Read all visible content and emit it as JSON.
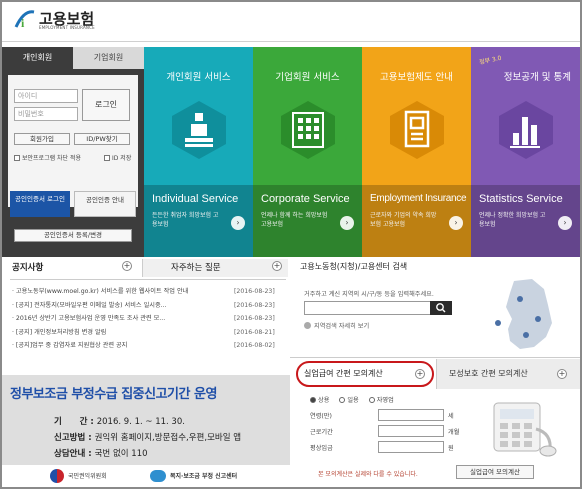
{
  "header": {
    "logo_text": "고용보험",
    "logo_sub": "EMPLOYMENT INSURANCE"
  },
  "login": {
    "tab_personal": "개인회원",
    "tab_corporate": "기업회원",
    "id_placeholder": "아이디",
    "pw_placeholder": "비밀번호",
    "login_button": "로그인",
    "signup_button": "회원가입",
    "find_button": "ID/PW찾기",
    "check_security": "보안프로그램 차단 적용",
    "check_save_id": "ID 저장",
    "cert_login": "공인인증서 로그인",
    "cert_guide": "공인인증 안내",
    "cert_register": "공인인증서 등록/변경"
  },
  "tiles": [
    {
      "title": "개인회원 서비스",
      "en": "Individual Service",
      "desc": "든든한 취업자 희망보험 고용보험",
      "color": "#16aab8"
    },
    {
      "title": "기업회원 서비스",
      "en": "Corporate Service",
      "desc": "언제나 함께 하는 희망보험 고용보험",
      "color": "#3aa83a"
    },
    {
      "title": "고용보험제도 안내",
      "en": "Employment Insurance",
      "desc": "근로자와 기업의 약속 희망보험 고용보험",
      "color": "#f1a318"
    },
    {
      "title": "정보공개 및 통계",
      "en": "Statistics Service",
      "desc": "언제나 정확한 희망보험 고용보험",
      "color": "#7f59b3",
      "badge": "정부 3.0"
    }
  ],
  "notices": {
    "tab_notice": "공지사항",
    "tab_faq": "자주하는 질문",
    "items": [
      {
        "title": "· 고용노동부(www.moel.go.kr) 서비스를 위한 웹사이트 작업 안내",
        "date": "[2016-08-23]"
      },
      {
        "title": "· [공지] 전자통지(모바일우편 이메일 발송) 서비스 일시중...",
        "date": "[2016-08-23]"
      },
      {
        "title": "· 2016년 상반기 고용보험사업 운영 만족도 조사 관련 모...",
        "date": "[2016-08-23]"
      },
      {
        "title": "· [공지] 개인정보처리방침 변경 알림",
        "date": "[2016-08-21]"
      },
      {
        "title": "· [공지]업무 중 감염자료 지원협상 관련 공지",
        "date": "[2016-08-02]"
      }
    ]
  },
  "search": {
    "title": "고용노동청(지청)/고용센터 검색",
    "desc": "거주하고 계신 지역의 시/구/동 등을 입력해주세요.",
    "local_link": "지역검색 자세히 보기"
  },
  "calc": {
    "tab_active": "실업급여 간편 모의계산",
    "tab_inactive": "모성보호 간편 모의계산",
    "radio_1": "상용",
    "radio_2": "일용",
    "radio_3": "자영업",
    "field_1": "연령(만)",
    "field_2": "근로기간",
    "field_3": "평상임금",
    "unit_1": "세",
    "unit_2": "개월",
    "unit_3": "원",
    "note": "본 모의계산은 실제와 다를 수 있습니다.",
    "button": "실업급여 모의계산"
  },
  "banner": {
    "title": "정부보조금 부정수급 집중신고기간 운영",
    "period_label": "기      간 :",
    "period_value": "2016. 9. 1. ~ 11. 30.",
    "method_label": "신고방법 :",
    "method_value": "권익위 홈페이지,방문접수,우편,모바일 앱",
    "contact_label": "상담안내 :",
    "contact_value": "국번 없이 110",
    "org_1": "국민권익위원회",
    "org_2": "복지·보조금 부정 신고센터"
  },
  "colors": {
    "highlight_circle": "#c8181b",
    "banner_title": "#1f4fa8"
  }
}
